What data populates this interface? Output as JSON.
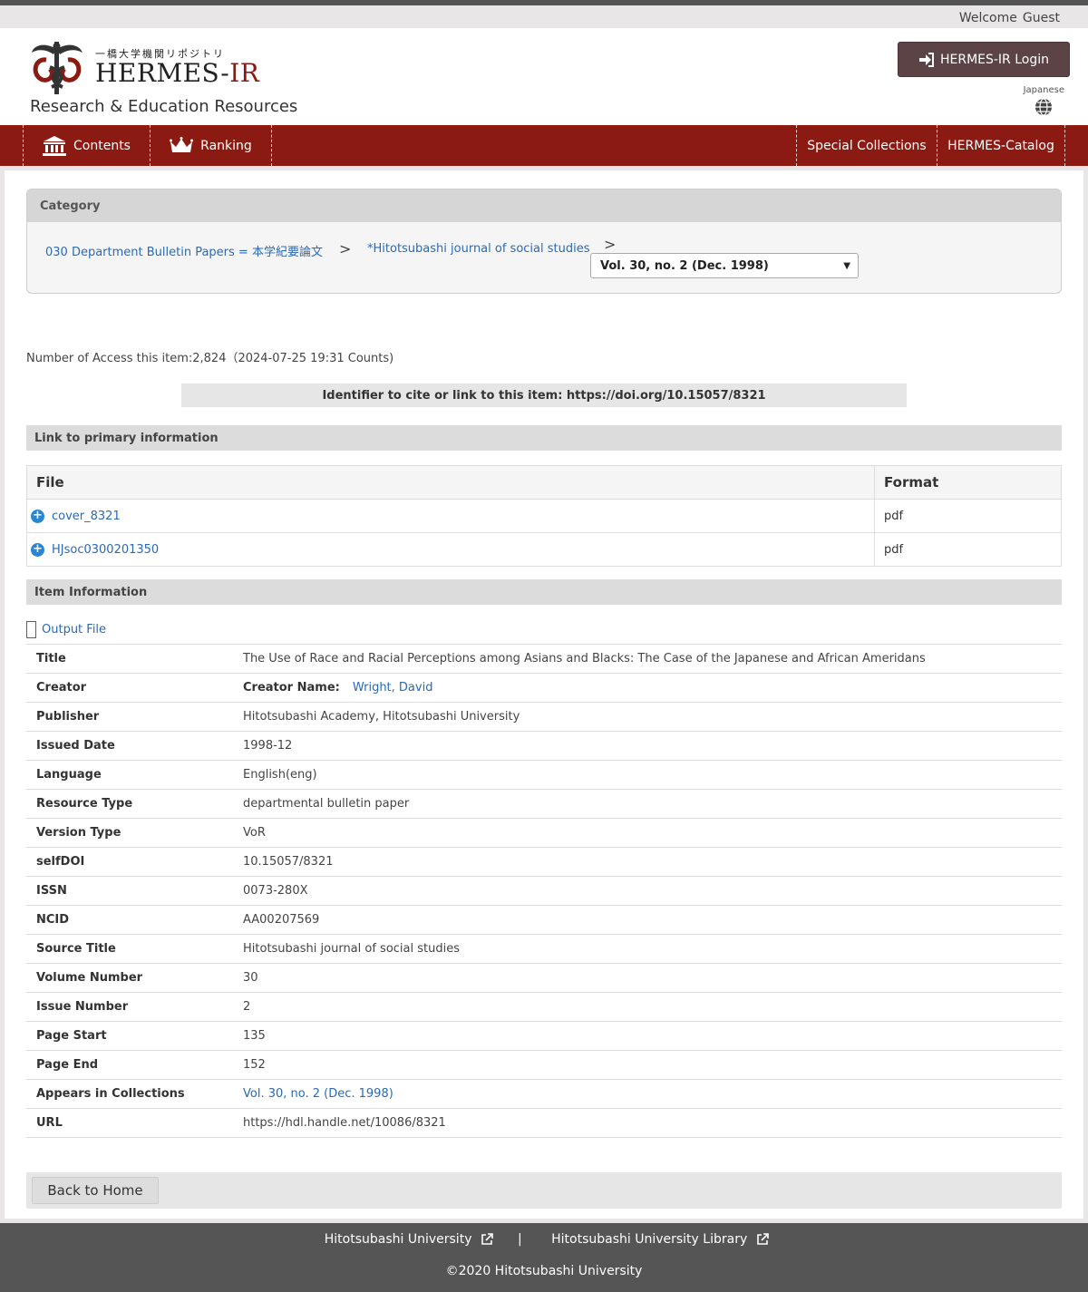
{
  "header": {
    "welcome": "Welcome",
    "user": "Guest",
    "logo_subtitle": "一橋大学機関リポジトリ",
    "logo_main": "HERMES-",
    "logo_main_accent": "IR",
    "tagline": "Research & Education Resources",
    "login_label": "HERMES-IR Login",
    "language_label": "Japanese"
  },
  "nav": {
    "contents": "Contents",
    "ranking": "Ranking",
    "special_collections": "Special Collections",
    "catalog": "HERMES-Catalog"
  },
  "category": {
    "heading": "Category",
    "crumb1": "030 Department Bulletin Papers = 本学紀要論文",
    "crumb2": "*Hitotsubashi journal of social studies",
    "separator": ">",
    "selected_volume": "Vol. 30, no. 2 (Dec. 1998)"
  },
  "access_text": "Number of Access this item:2,824（2024-07-25 19:31 Counts)",
  "identifier_text": "Identifier to cite or link to this item: https://doi.org/10.15057/8321",
  "primary": {
    "heading": "Link to primary information",
    "col_file": "File",
    "col_format": "Format",
    "files": [
      {
        "name": "cover_8321",
        "format": "pdf"
      },
      {
        "name": "HJsoc0300201350",
        "format": "pdf"
      }
    ]
  },
  "item": {
    "heading": "Item Information",
    "output_file": "Output File",
    "creator_label": "Creator Name:",
    "rows": [
      {
        "key": "Title",
        "value": "The Use of Race and Racial Perceptions among Asians and Blacks: The Case of the Japanese and African Ameridans"
      },
      {
        "key": "Creator",
        "value": "Wright, David"
      },
      {
        "key": "Publisher",
        "value": "Hitotsubashi Academy, Hitotsubashi University"
      },
      {
        "key": "Issued Date",
        "value": "1998-12"
      },
      {
        "key": "Language",
        "value": "English(eng)"
      },
      {
        "key": "Resource Type",
        "value": "departmental bulletin paper"
      },
      {
        "key": "Version Type",
        "value": "VoR"
      },
      {
        "key": "selfDOI",
        "value": "10.15057/8321"
      },
      {
        "key": "ISSN",
        "value": "0073-280X"
      },
      {
        "key": "NCID",
        "value": "AA00207569"
      },
      {
        "key": "Source Title",
        "value": "Hitotsubashi journal of social studies"
      },
      {
        "key": "Volume Number",
        "value": "30"
      },
      {
        "key": "Issue Number",
        "value": "2"
      },
      {
        "key": "Page Start",
        "value": "135"
      },
      {
        "key": "Page End",
        "value": "152"
      },
      {
        "key": "Appears in Collections",
        "value": "Vol. 30, no. 2 (Dec. 1998)"
      },
      {
        "key": "URL",
        "value": "https://hdl.handle.net/10086/8321"
      }
    ]
  },
  "back_label": "Back to Home",
  "footer": {
    "link1": "Hitotsubashi University",
    "divider": "|",
    "link2": "Hitotsubashi University Library",
    "copyright": "©2020 Hitotsubashi University"
  },
  "colors": {
    "brand_red": "#8b1a13",
    "login_bg": "#5c4446",
    "link": "#2a6ab5",
    "footer_bg": "#555555"
  }
}
